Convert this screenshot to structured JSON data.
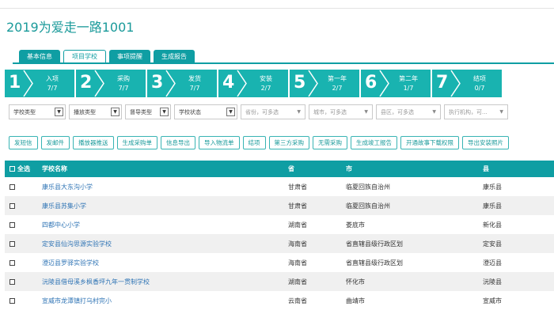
{
  "page": {
    "title": "2019为爱走一路1001"
  },
  "tabs": [
    {
      "label": "基本信息",
      "active": false
    },
    {
      "label": "项目学校",
      "active": true
    },
    {
      "label": "事项提醒",
      "active": false
    },
    {
      "label": "生成报告",
      "active": false
    }
  ],
  "steps": [
    {
      "num": "1",
      "name": "入项",
      "count": "7/7"
    },
    {
      "num": "2",
      "name": "采购",
      "count": "7/7"
    },
    {
      "num": "3",
      "name": "发货",
      "count": "7/7"
    },
    {
      "num": "4",
      "name": "安装",
      "count": "2/7"
    },
    {
      "num": "5",
      "name": "第一年",
      "count": "2/7"
    },
    {
      "num": "6",
      "name": "第二年",
      "count": "1/7"
    },
    {
      "num": "7",
      "name": "结项",
      "count": "0/7"
    }
  ],
  "filters": [
    {
      "value": "学校类型",
      "placeholder": "",
      "kind": "select"
    },
    {
      "value": "播放类型",
      "placeholder": "",
      "kind": "select"
    },
    {
      "value": "督导类型",
      "placeholder": "",
      "kind": "select"
    },
    {
      "value": "学校状态",
      "placeholder": "",
      "kind": "select"
    },
    {
      "value": "",
      "placeholder": "省份，可多选",
      "kind": "multi"
    },
    {
      "value": "",
      "placeholder": "城市，可多选",
      "kind": "multi"
    },
    {
      "value": "",
      "placeholder": "县区，可多选",
      "kind": "multi"
    },
    {
      "value": "",
      "placeholder": "执行机构，可...",
      "kind": "multi"
    }
  ],
  "actions": [
    "发短信",
    "发邮件",
    "播放器推送",
    "生成采购单",
    "信息导出",
    "导入物流单",
    "结项",
    "第三方采购",
    "无需采购",
    "生成竣工报告",
    "开通故事下载权限",
    "导出安装照片"
  ],
  "table": {
    "select_all_label": "全选",
    "headers": {
      "name": "学校名称",
      "province": "省",
      "city": "市",
      "county": "县"
    },
    "rows": [
      {
        "name": "康乐县大东沟小学",
        "province": "甘肃省",
        "city": "临夏回族自治州",
        "county": "康乐县"
      },
      {
        "name": "康乐县苏集小学",
        "province": "甘肃省",
        "city": "临夏回族自治州",
        "county": "康乐县"
      },
      {
        "name": "四都中心小学",
        "province": "湖南省",
        "city": "娄底市",
        "county": "新化县"
      },
      {
        "name": "定安县仙沟思源实验学校",
        "province": "海南省",
        "city": "省直辖县级行政区划",
        "county": "定安县"
      },
      {
        "name": "澄迈县罗驿实验学校",
        "province": "海南省",
        "city": "省直辖县级行政区划",
        "county": "澄迈县"
      },
      {
        "name": "沅陵县借母溪乡枫香坪九年一贯制学校",
        "province": "湖南省",
        "city": "怀化市",
        "county": "沅陵县"
      },
      {
        "name": "宣威市龙潭镇打乌村完小",
        "province": "云南省",
        "city": "曲靖市",
        "county": "宣威市"
      }
    ]
  },
  "colors": {
    "accent": "#0f9ea3",
    "step": "#19b3b0",
    "link": "#2f74b5",
    "title": "#1a9a9a"
  }
}
